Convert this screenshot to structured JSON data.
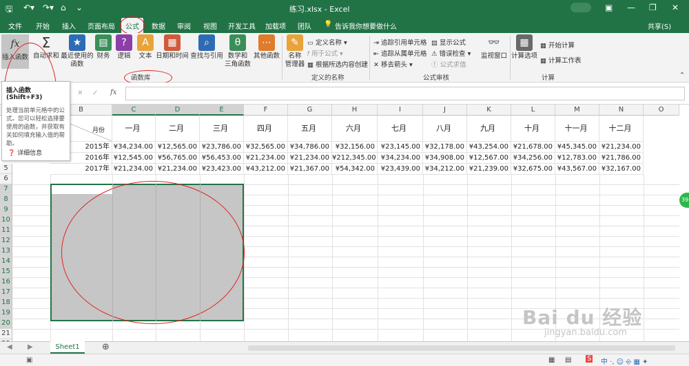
{
  "window": {
    "title": "练习.xlsx  -  Excel",
    "user": "共享(S)"
  },
  "tabs": [
    "文件",
    "开始",
    "插入",
    "页面布局",
    "公式",
    "数据",
    "审阅",
    "视图",
    "开发工具",
    "加载项",
    "团队"
  ],
  "active_tab": "公式",
  "tell_me": "告诉我你想要做什么",
  "ribbon": {
    "insert_function": "插入函数",
    "autosum": "自动求和",
    "recent": "最近使用的",
    "recent2": "函数",
    "finance": "财务",
    "logic": "逻辑",
    "text": "文本",
    "datetime": "日期和时间",
    "lookup": "查找与引用",
    "math": "数学和",
    "math2": "三角函数",
    "other": "其他函数",
    "group_lib": "函数库",
    "name_mgr": "名称",
    "name_mgr2": "管理器",
    "define_name": "定义名称",
    "use_in_formula": "用于公式",
    "create_from_sel": "根据所选内容创建",
    "group_names": "定义的名称",
    "trace_prec": "追踪引用单元格",
    "trace_dep": "追踪从属单元格",
    "remove_arrows": "移去箭头",
    "show_formulas": "显示公式",
    "error_check": "错误检查",
    "eval_formula": "公式求值",
    "group_audit": "公式审核",
    "watch": "监视窗口",
    "calc_options": "计算选项",
    "calc_now": "开始计算",
    "calc_sheet": "计算工作表",
    "group_calc": "计算"
  },
  "tooltip": {
    "title": "插入函数 (Shift+F3)",
    "desc": "处理当前单元格中的公式。您可以轻松选择要使用的函数，并获取有关如何填充输入值的帮助。",
    "more": "详细信息"
  },
  "columns": [
    "B",
    "C",
    "D",
    "E",
    "F",
    "G",
    "H",
    "I",
    "J",
    "K",
    "L",
    "M",
    "N",
    "O"
  ],
  "header_row": {
    "corner": "月份",
    "months": [
      "一月",
      "二月",
      "三月",
      "四月",
      "五月",
      "六月",
      "七月",
      "八月",
      "九月",
      "十月",
      "十一月",
      "十二月"
    ]
  },
  "rows": [
    {
      "year": "2015年",
      "values": [
        "¥34,234.00",
        "¥12,565.00",
        "¥23,786.00",
        "¥32,565.00",
        "¥34,786.00",
        "¥32,156.00",
        "¥23,145.00",
        "¥32,178.00",
        "¥43,254.00",
        "¥21,678.00",
        "¥45,345.00",
        "¥21,234.00"
      ]
    },
    {
      "year": "2016年",
      "values": [
        "¥12,545.00",
        "¥56,765.00",
        "¥56,453.00",
        "¥21,234.00",
        "¥21,234.00",
        "¥212,345.00",
        "¥34,234.00",
        "¥34,908.00",
        "¥12,567.00",
        "¥34,256.00",
        "¥12,783.00",
        "¥21,786.00"
      ]
    },
    {
      "year": "2017年",
      "values": [
        "¥21,234.00",
        "¥21,234.00",
        "¥23,423.00",
        "¥43,212.00",
        "¥21,367.00",
        "¥54,342.00",
        "¥23,439.00",
        "¥34,212.00",
        "¥21,239.00",
        "¥32,675.00",
        "¥43,567.00",
        "¥32,167.00"
      ]
    }
  ],
  "row_numbers": [
    "5",
    "6",
    "7",
    "8",
    "9",
    "10",
    "11",
    "12",
    "13",
    "14",
    "15",
    "16",
    "17",
    "18",
    "19",
    "20",
    "21",
    "22"
  ],
  "sheet": "Sheet1",
  "watermark": "Bai du 经验",
  "watermark_url": "jingyan.baidu.com",
  "bubble": "39"
}
